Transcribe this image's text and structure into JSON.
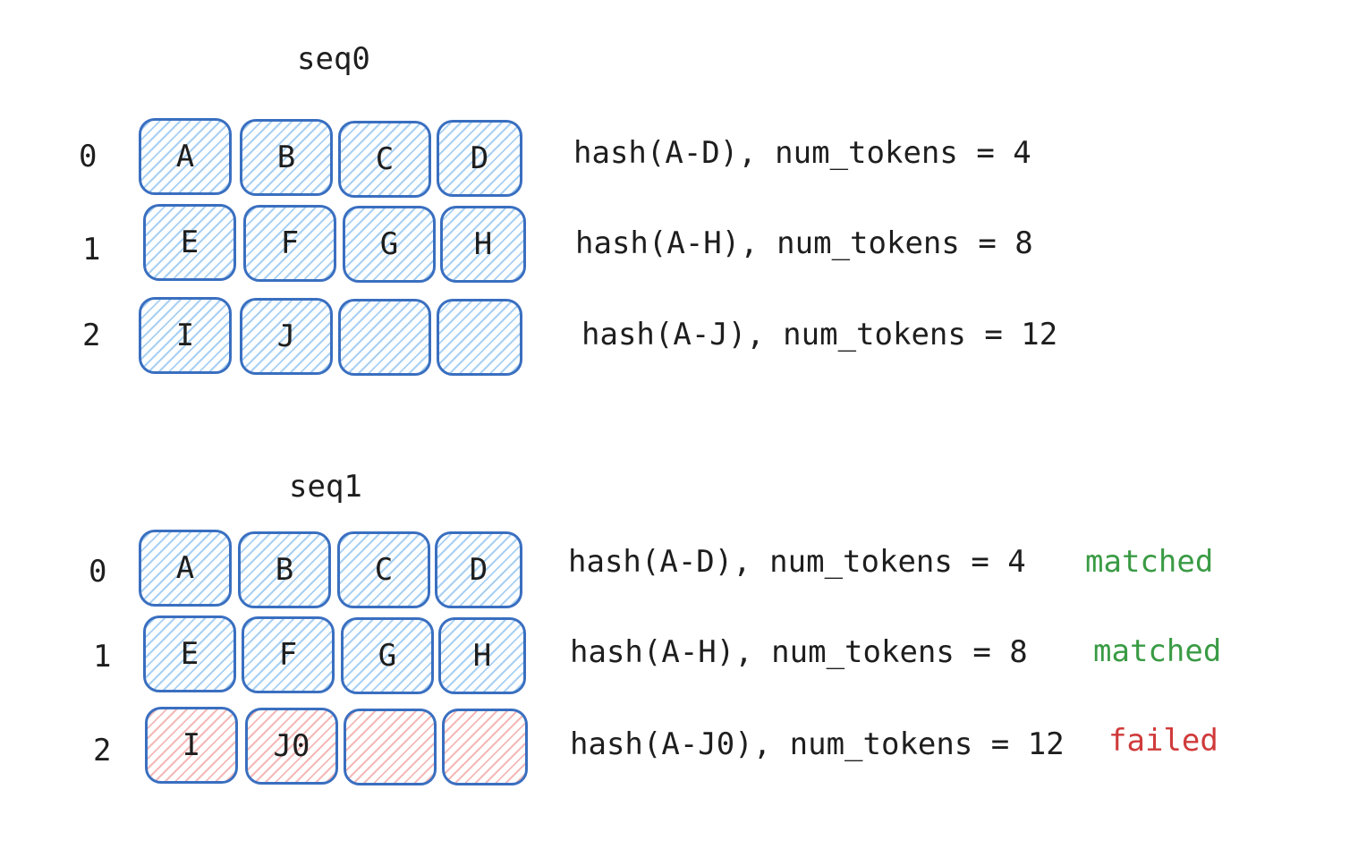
{
  "colors": {
    "cell_border": "#3a6fc0",
    "hatch_blue": "#a8d0f3",
    "hatch_red": "#f4b9b7",
    "matched": "#3a9b45",
    "failed": "#d03a3a",
    "text": "#1e1e1e"
  },
  "sequences": [
    {
      "title": "seq0",
      "rows": [
        {
          "index": "0",
          "cells": [
            {
              "label": "A",
              "state": "blue"
            },
            {
              "label": "B",
              "state": "blue"
            },
            {
              "label": "C",
              "state": "blue"
            },
            {
              "label": "D",
              "state": "blue"
            }
          ],
          "hash": "hash(A-D), num_tokens = 4",
          "status": ""
        },
        {
          "index": "1",
          "cells": [
            {
              "label": "E",
              "state": "blue"
            },
            {
              "label": "F",
              "state": "blue"
            },
            {
              "label": "G",
              "state": "blue"
            },
            {
              "label": "H",
              "state": "blue"
            }
          ],
          "hash": "hash(A-H), num_tokens = 8",
          "status": ""
        },
        {
          "index": "2",
          "cells": [
            {
              "label": "I",
              "state": "blue"
            },
            {
              "label": "J",
              "state": "blue"
            },
            {
              "label": "",
              "state": "blue"
            },
            {
              "label": "",
              "state": "blue"
            }
          ],
          "hash": "hash(A-J), num_tokens = 12",
          "status": ""
        }
      ]
    },
    {
      "title": "seq1",
      "rows": [
        {
          "index": "0",
          "cells": [
            {
              "label": "A",
              "state": "blue"
            },
            {
              "label": "B",
              "state": "blue"
            },
            {
              "label": "C",
              "state": "blue"
            },
            {
              "label": "D",
              "state": "blue"
            }
          ],
          "hash": "hash(A-D), num_tokens = 4",
          "status": "matched"
        },
        {
          "index": "1",
          "cells": [
            {
              "label": "E",
              "state": "blue"
            },
            {
              "label": "F",
              "state": "blue"
            },
            {
              "label": "G",
              "state": "blue"
            },
            {
              "label": "H",
              "state": "blue"
            }
          ],
          "hash": "hash(A-H), num_tokens = 8",
          "status": "matched"
        },
        {
          "index": "2",
          "cells": [
            {
              "label": "I",
              "state": "red"
            },
            {
              "label": "J0",
              "state": "red"
            },
            {
              "label": "",
              "state": "red"
            },
            {
              "label": "",
              "state": "red"
            }
          ],
          "hash": "hash(A-J0), num_tokens = 12",
          "status": "failed"
        }
      ]
    }
  ]
}
